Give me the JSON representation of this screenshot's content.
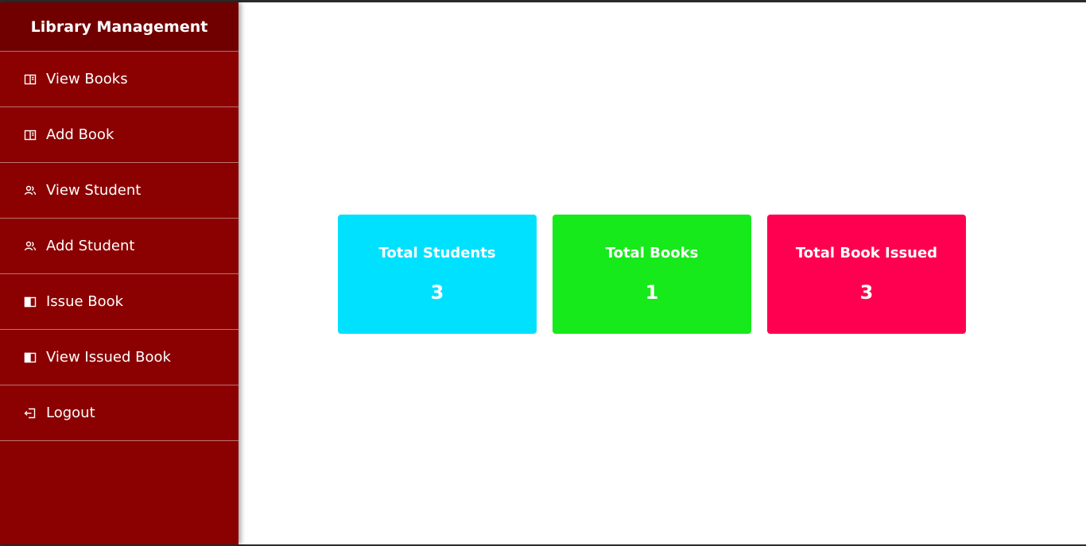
{
  "app": {
    "title": "Library Management"
  },
  "sidebar": {
    "items": [
      {
        "label": "View Books",
        "icon": "book-icon"
      },
      {
        "label": "Add Book",
        "icon": "book-icon"
      },
      {
        "label": "View Student",
        "icon": "users-icon"
      },
      {
        "label": "Add Student",
        "icon": "users-icon"
      },
      {
        "label": "Issue Book",
        "icon": "book-open-icon"
      },
      {
        "label": "View Issued Book",
        "icon": "book-open-icon"
      },
      {
        "label": "Logout",
        "icon": "logout-icon"
      }
    ]
  },
  "cards": [
    {
      "title": "Total Students",
      "value": "3",
      "color": "#00e1ff"
    },
    {
      "title": "Total Books",
      "value": "1",
      "color": "#16ea1a"
    },
    {
      "title": "Total Book Issued",
      "value": "3",
      "color": "#ff0050"
    }
  ],
  "colors": {
    "sidebar_bg": "#8b0000",
    "sidebar_header_bg": "#700000"
  }
}
